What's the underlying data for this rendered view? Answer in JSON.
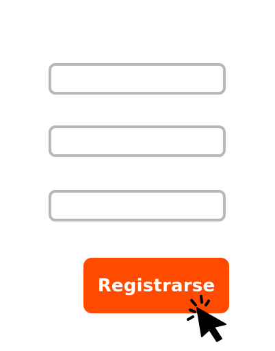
{
  "form": {
    "fields": [
      {
        "value": "",
        "placeholder": ""
      },
      {
        "value": "",
        "placeholder": ""
      },
      {
        "value": "",
        "placeholder": ""
      }
    ],
    "submit_label": "Registrarse"
  },
  "colors": {
    "button": "#ff4a00",
    "field_border": "#b8b8b8",
    "cursor": "#000000"
  },
  "icons": {
    "cursor": "click-cursor-icon"
  }
}
